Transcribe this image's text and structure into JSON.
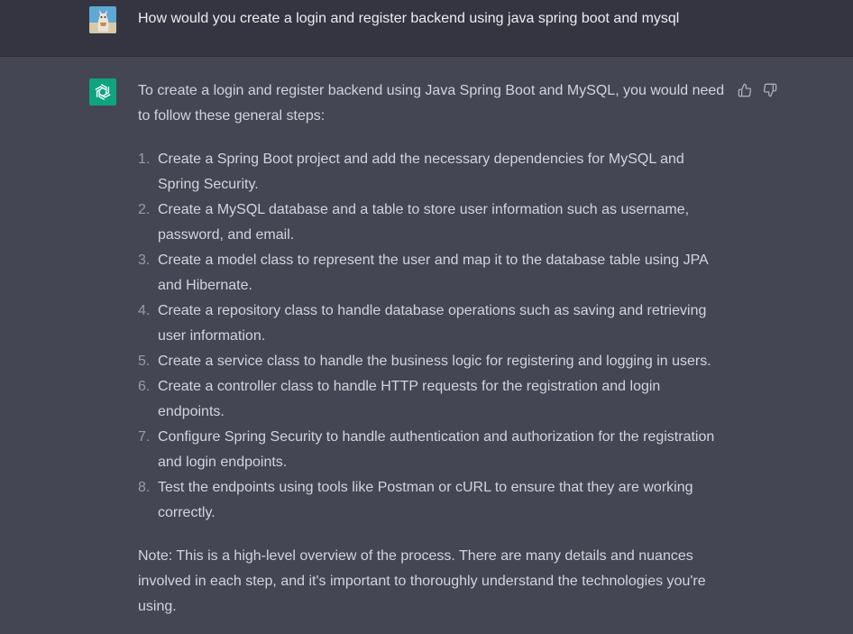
{
  "user_message": {
    "text": "How would you create a login and register backend using java spring boot and mysql"
  },
  "assistant_message": {
    "intro": "To create a login and register backend using Java Spring Boot and MySQL, you would need to follow these general steps:",
    "steps": [
      {
        "num": "1.",
        "text": "Create a Spring Boot project and add the necessary dependencies for MySQL and Spring Security."
      },
      {
        "num": "2.",
        "text": "Create a MySQL database and a table to store user information such as username, password, and email."
      },
      {
        "num": "3.",
        "text": "Create a model class to represent the user and map it to the database table using JPA and Hibernate."
      },
      {
        "num": "4.",
        "text": "Create a repository class to handle database operations such as saving and retrieving user information."
      },
      {
        "num": "5.",
        "text": "Create a service class to handle the business logic for registering and logging in users."
      },
      {
        "num": "6.",
        "text": "Create a controller class to handle HTTP requests for the registration and login endpoints."
      },
      {
        "num": "7.",
        "text": "Configure Spring Security to handle authentication and authorization for the registration and login endpoints."
      },
      {
        "num": "8.",
        "text": "Test the endpoints using tools like Postman or cURL to ensure that they are working correctly."
      }
    ],
    "note": "Note: This is a high-level overview of the process. There are many details and nuances involved in each step, and it's important to thoroughly understand the technologies you're using."
  },
  "icons": {
    "user_avatar": "user-avatar-cat",
    "assistant_avatar": "openai-logo-icon",
    "thumbs_up": "thumbs-up-icon",
    "thumbs_down": "thumbs-down-icon"
  },
  "colors": {
    "user_row_bg": "#343541",
    "assistant_row_bg": "#444654",
    "assistant_avatar_bg": "#10a37f",
    "text": "#d1d5db",
    "user_text": "#ececf1"
  }
}
